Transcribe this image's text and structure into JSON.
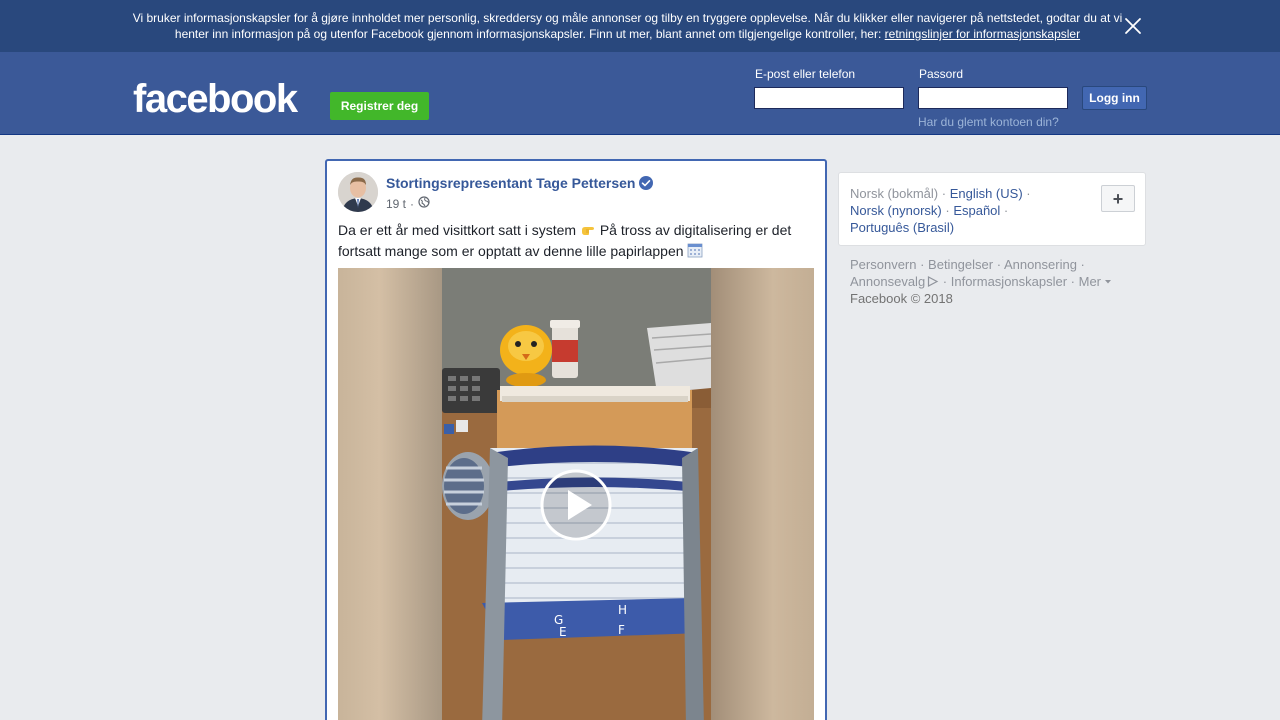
{
  "cookie_banner": {
    "text": "Vi bruker informasjonskapsler for å gjøre innholdet mer personlig, skreddersy og måle annonser og tilby en tryggere opplevelse. Når du klikker eller navigerer på nettstedet, godtar du at vi henter inn informasjon på og utenfor Facebook gjennom informasjonskapsler. Finn ut mer, blant annet om tilgjengelige kontroller, her: ",
    "link_text": "retningslinjer for informasjonskapsler",
    "close_icon": "close-icon"
  },
  "header": {
    "logo": "facebook",
    "register_label": "Registrer deg",
    "email_label": "E-post eller telefon",
    "email_value": "",
    "password_label": "Passord",
    "password_value": "",
    "login_label": "Logg inn",
    "forgot_link": "Har du glemt kontoen din?"
  },
  "post": {
    "author": "Stortingsrepresentant Tage Pettersen",
    "verified_icon": "verified-badge-icon",
    "time": "19 t",
    "separator": "·",
    "audience_icon": "globe-icon",
    "text_part1": "Da er ett år med visittkort satt i system ",
    "emoji1": "👉",
    "text_part2": " På tross av digitalisering er det fortsatt mange som er opptatt av denne lille papirlappen ",
    "emoji2": "📅",
    "video_play_icon": "play-icon"
  },
  "languages": {
    "current": "Norsk (bokmål)",
    "items": [
      "English (US)",
      "Norsk (nynorsk)",
      "Español",
      "Português (Brasil)"
    ],
    "add_label": "+"
  },
  "footer": {
    "links": [
      "Personvern",
      "Betingelser",
      "Annonsering",
      "Annonsevalg",
      "Informasjonskapsler",
      "Mer"
    ],
    "copyright": "Facebook © 2018"
  },
  "colors": {
    "brand_blue": "#3b5998",
    "banner_blue": "#29487d",
    "register_green": "#42b72a",
    "link_blue": "#365899",
    "background": "#e9ebee"
  }
}
